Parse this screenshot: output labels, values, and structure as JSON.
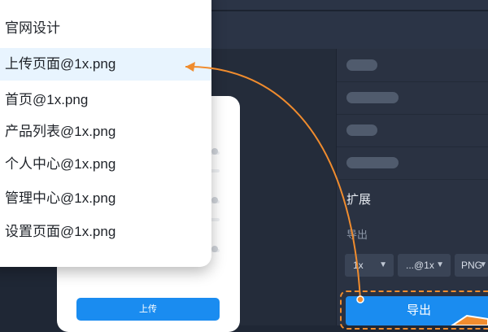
{
  "dropdown": {
    "header": "官网设计",
    "items": [
      {
        "label": "上传页面@1x.png",
        "selected": true
      },
      {
        "label": "首页@1x.png",
        "selected": false
      },
      {
        "label": "产品列表@1x.png",
        "selected": false
      },
      {
        "label": "个人中心@1x.png",
        "selected": false
      },
      {
        "label": "管理中心@1x.png",
        "selected": false
      },
      {
        "label": "设置页面@1x.png",
        "selected": false
      }
    ]
  },
  "upload_card": {
    "upload_label": "上传"
  },
  "inspector": {
    "section_title": "扩展",
    "export_subtitle": "导出",
    "scale_value": "1x",
    "suffix_value": "...@1x",
    "format_value": "PNG",
    "export_button": "导出"
  },
  "colors": {
    "accent": "#1a8cf0",
    "annotation": "#f08c2e",
    "background_dark": "#1f2735"
  }
}
